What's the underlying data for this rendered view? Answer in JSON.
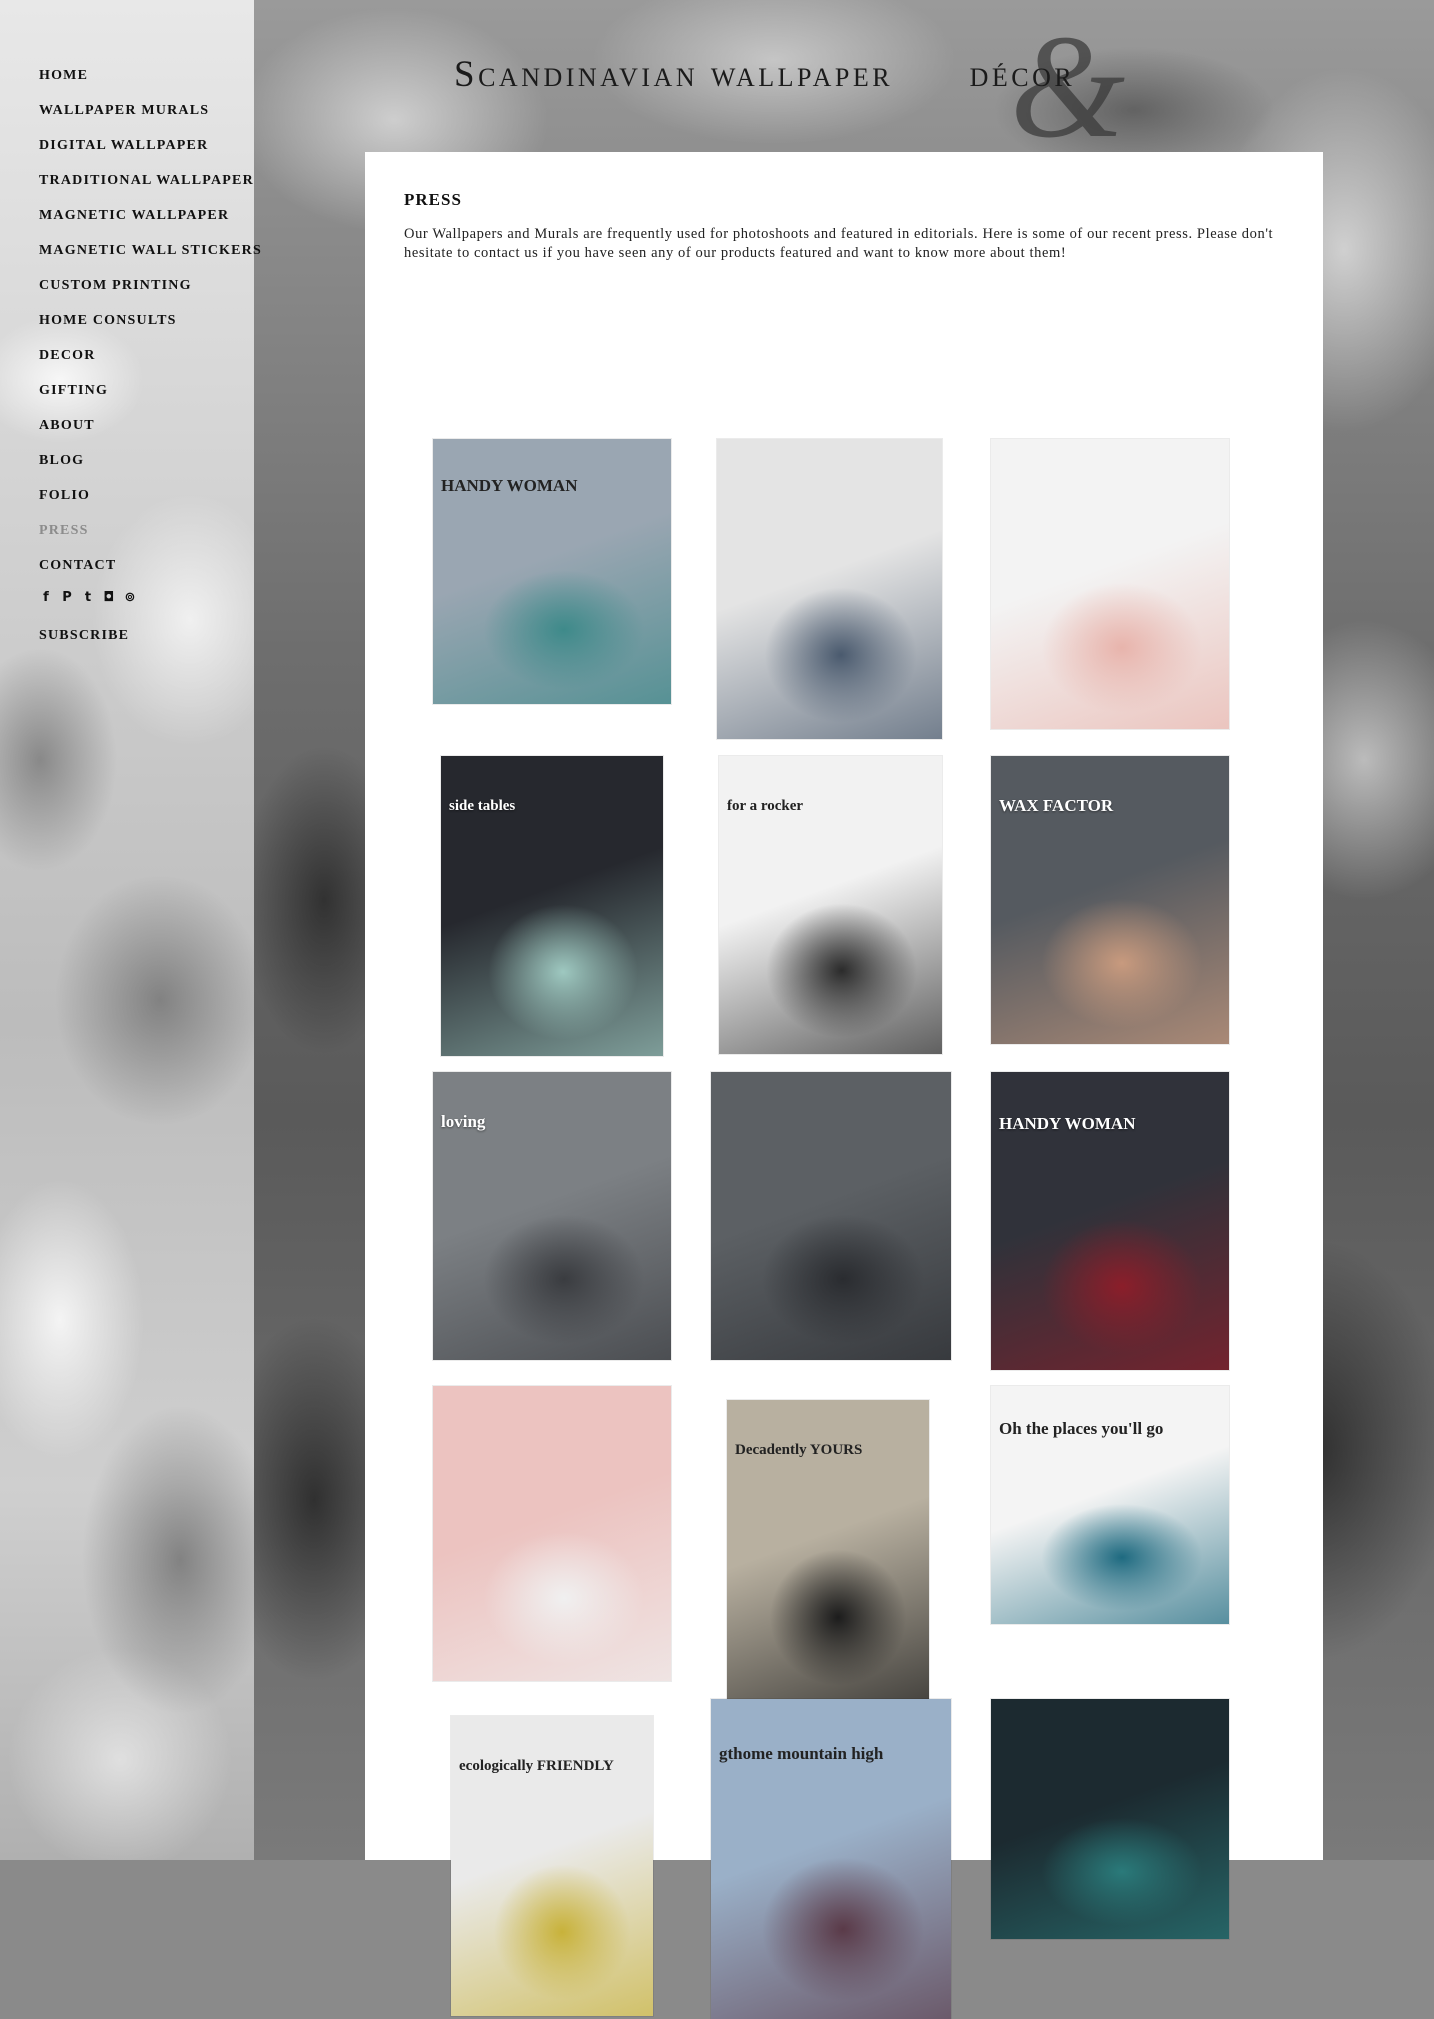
{
  "brand": {
    "logo_text": "Scandinavian wallpaper",
    "logo_amp": "&",
    "logo_tail": "décor"
  },
  "nav": {
    "items": [
      {
        "label": "HOME"
      },
      {
        "label": "WALLPAPER MURALS"
      },
      {
        "label": "DIGITAL WALLPAPER"
      },
      {
        "label": "TRADITIONAL WALLPAPER"
      },
      {
        "label": "MAGNETIC WALLPAPER"
      },
      {
        "label": "MAGNETIC WALL STICKERS"
      },
      {
        "label": "CUSTOM PRINTING"
      },
      {
        "label": "HOME CONSULTS"
      },
      {
        "label": "DECOR"
      },
      {
        "label": "GIFTING"
      },
      {
        "label": "ABOUT"
      },
      {
        "label": "BLOG"
      },
      {
        "label": "FOLIO"
      },
      {
        "label": "PRESS",
        "active": true
      },
      {
        "label": "CONTACT"
      }
    ],
    "social": [
      {
        "icon": "facebook-icon",
        "glyph": "f"
      },
      {
        "icon": "pinterest-icon",
        "glyph": "P"
      },
      {
        "icon": "twitter-icon",
        "glyph": "t"
      },
      {
        "icon": "instagram-icon",
        "glyph": "◘"
      },
      {
        "icon": "rss-icon",
        "glyph": "⊚"
      }
    ],
    "subscribe": "SUBSCRIBE"
  },
  "page": {
    "title": "PRESS",
    "intro": "Our Wallpapers and Murals are frequently used for photoshoots and featured in editorials. Here is some of our recent press. Please don't hesitate to contact us if you have seen any of our products featured and want to know more about them!"
  },
  "press": [
    {
      "caption": "HANDY WOMAN",
      "colors": [
        "#9aa6b2",
        "#3e8a8a"
      ]
    },
    {
      "caption": "",
      "colors": [
        "#e4e4e4",
        "#4a5a6e"
      ]
    },
    {
      "caption": "",
      "colors": [
        "#f3f3f3",
        "#e8b4ac"
      ]
    },
    {
      "caption": "side tables",
      "colors": [
        "#26282e",
        "#9ec8c0"
      ]
    },
    {
      "caption": "for a rocker",
      "colors": [
        "#f2f2f2",
        "#2b2b2b"
      ]
    },
    {
      "caption": "WAX FACTOR",
      "colors": [
        "#555a60",
        "#c89a7e"
      ]
    },
    {
      "caption": "loving",
      "colors": [
        "#7c8084",
        "#3a3c40"
      ]
    },
    {
      "caption": "",
      "colors": [
        "#5c6064",
        "#2a2c30"
      ]
    },
    {
      "caption": "HANDY WOMAN",
      "colors": [
        "#30323a",
        "#8b1e2a"
      ]
    },
    {
      "caption": "",
      "colors": [
        "#ecc3c0",
        "#f0f0f0"
      ]
    },
    {
      "caption": "Decadently YOURS",
      "colors": [
        "#b8b0a0",
        "#1c1c1c"
      ]
    },
    {
      "caption": "Oh the places you'll go",
      "colors": [
        "#f4f4f4",
        "#1e6a80"
      ]
    },
    {
      "caption": "ecologically FRIENDLY",
      "colors": [
        "#eaeaea",
        "#c8b23a"
      ]
    },
    {
      "caption": "gthome mountain high",
      "colors": [
        "#9ab0c8",
        "#5a3a48"
      ]
    },
    {
      "caption": "",
      "colors": [
        "#1c2a30",
        "#2a7a7a"
      ]
    }
  ]
}
